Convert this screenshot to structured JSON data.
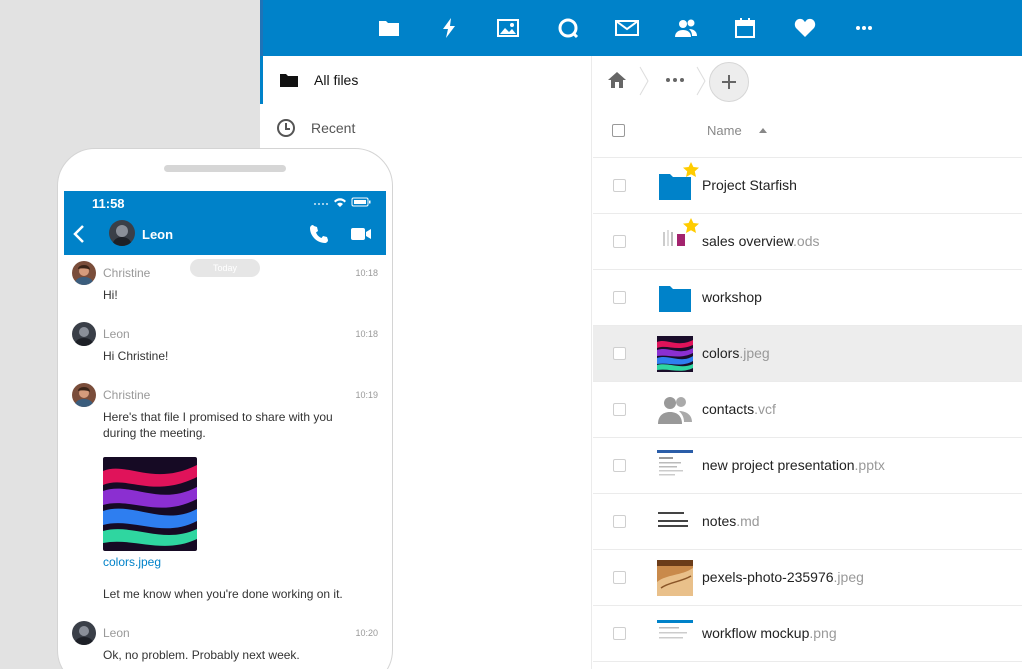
{
  "desktop": {
    "app_icons": [
      "folder-icon",
      "activity-icon",
      "gallery-icon",
      "talk-icon",
      "mail-icon",
      "contacts-icon",
      "calendar-icon",
      "favorites-icon",
      "more-icon"
    ],
    "nav": [
      {
        "label": "All files",
        "icon": "folder-icon"
      },
      {
        "label": "Recent",
        "icon": "clock-icon"
      }
    ],
    "breadcrumb": {
      "home_icon": "home-icon",
      "more_icon": "more-icon",
      "add_icon": "plus-icon"
    },
    "table": {
      "name_header": "Name",
      "rows": [
        {
          "name": "Project Starfish",
          "ext": "",
          "type": "folder",
          "starred": true
        },
        {
          "name": "sales overview",
          "ext": ".ods",
          "type": "spreadsheet",
          "starred": true
        },
        {
          "name": "workshop",
          "ext": "",
          "type": "folder",
          "starred": false
        },
        {
          "name": "colors",
          "ext": ".jpeg",
          "type": "image",
          "starred": false
        },
        {
          "name": "contacts",
          "ext": ".vcf",
          "type": "contacts",
          "starred": false
        },
        {
          "name": "new project presentation",
          "ext": ".pptx",
          "type": "presentation",
          "starred": false
        },
        {
          "name": "notes",
          "ext": ".md",
          "type": "text",
          "starred": false
        },
        {
          "name": "pexels-photo-235976",
          "ext": ".jpeg",
          "type": "photo",
          "starred": false
        },
        {
          "name": "workflow mockup",
          "ext": ".png",
          "type": "mockup",
          "starred": false
        }
      ]
    }
  },
  "phone": {
    "time": "11:58",
    "contact": "Leon",
    "today": "Today",
    "messages": [
      {
        "author": "Christine",
        "time": "10:18",
        "text": "Hi!"
      },
      {
        "author": "Leon",
        "time": "10:18",
        "text": "Hi Christine!"
      },
      {
        "author": "Christine",
        "time": "10:19",
        "text": "Here's that file I promised to share with you during the meeting.",
        "file": "colors.jpeg",
        "followup": "Let me know when you're done working on it."
      },
      {
        "author": "Leon",
        "time": "10:20",
        "text": "Ok, no problem. Probably next week."
      }
    ]
  },
  "colors": {
    "brand": "#0082c9",
    "star": "#ffcc00",
    "highlight_row": "#ededed"
  }
}
